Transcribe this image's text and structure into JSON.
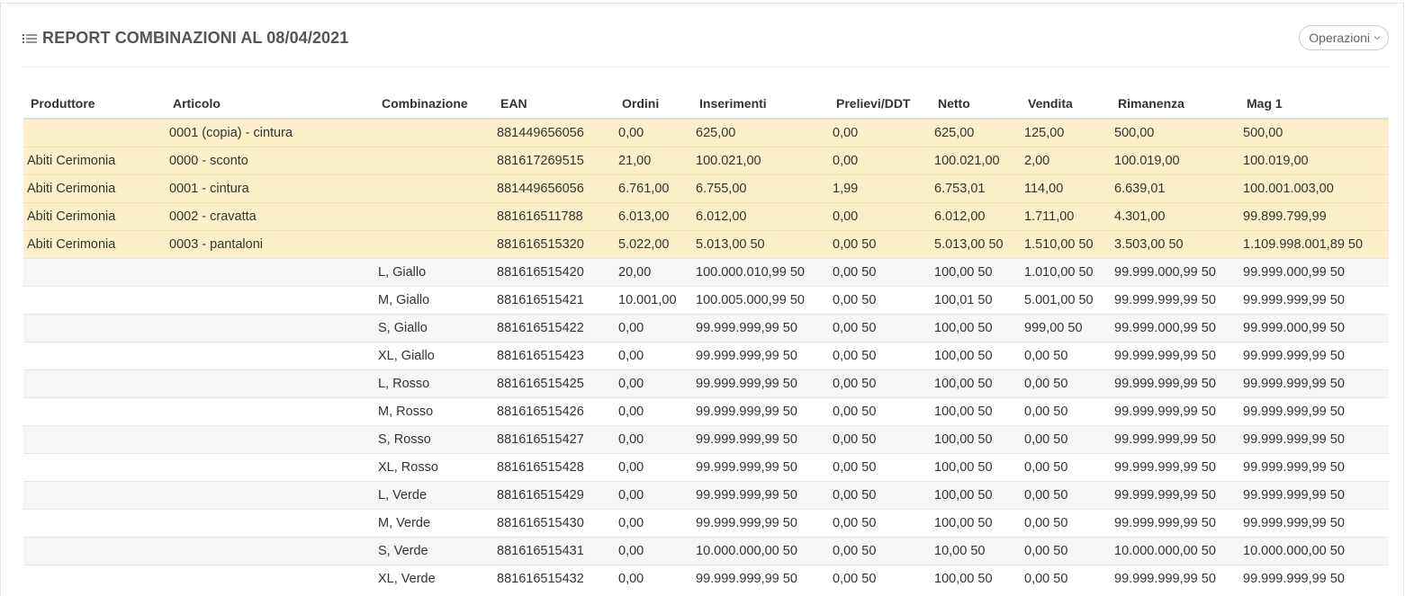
{
  "header": {
    "title": "REPORT COMBINAZIONI AL 08/04/2021",
    "title_icon": "list-icon",
    "operations_label": "Operazioni"
  },
  "table": {
    "columns": [
      "Produttore",
      "Articolo",
      "Combinazione",
      "EAN",
      "Ordini",
      "Inserimenti",
      "Prelievi/DDT",
      "Netto",
      "Vendita",
      "Rimanenza",
      "Mag 1"
    ],
    "rows": [
      {
        "type": "product",
        "cells": [
          "",
          "0001 (copia) - cintura",
          "",
          "881449656056",
          "0,00",
          "625,00",
          "0,00",
          "625,00",
          "125,00",
          "500,00",
          "500,00"
        ]
      },
      {
        "type": "product",
        "cells": [
          "Abiti Cerimonia",
          "0000 - sconto",
          "",
          "881617269515",
          "21,00",
          "100.021,00",
          "0,00",
          "100.021,00",
          "2,00",
          "100.019,00",
          "100.019,00"
        ]
      },
      {
        "type": "product",
        "cells": [
          "Abiti Cerimonia",
          "0001 - cintura",
          "",
          "881449656056",
          "6.761,00",
          "6.755,00",
          "1,99",
          "6.753,01",
          "114,00",
          "6.639,01",
          "100.001.003,00"
        ]
      },
      {
        "type": "product",
        "cells": [
          "Abiti Cerimonia",
          "0002 - cravatta",
          "",
          "881616511788",
          "6.013,00",
          "6.012,00",
          "0,00",
          "6.012,00",
          "1.711,00",
          "4.301,00",
          "99.899.799,99"
        ]
      },
      {
        "type": "product",
        "cells": [
          "Abiti Cerimonia",
          "0003 - pantaloni",
          "",
          "881616515320",
          "5.022,00",
          "5.013,00 50",
          "0,00 50",
          "5.013,00 50",
          "1.510,00 50",
          "3.503,00 50",
          "1.109.998.001,89 50"
        ]
      },
      {
        "type": "combination",
        "cells": [
          "",
          "",
          "L, Giallo",
          "881616515420",
          "20,00",
          "100.000.010,99 50",
          "0,00 50",
          "100,00 50",
          "1.010,00 50",
          "99.999.000,99 50",
          "99.999.000,99 50"
        ]
      },
      {
        "type": "combination",
        "cells": [
          "",
          "",
          "M, Giallo",
          "881616515421",
          "10.001,00",
          "100.005.000,99 50",
          "0,00 50",
          "100,01 50",
          "5.001,00 50",
          "99.999.999,99 50",
          "99.999.999,99 50"
        ]
      },
      {
        "type": "combination",
        "cells": [
          "",
          "",
          "S, Giallo",
          "881616515422",
          "0,00",
          "99.999.999,99 50",
          "0,00 50",
          "100,00 50",
          "999,00 50",
          "99.999.000,99 50",
          "99.999.000,99 50"
        ]
      },
      {
        "type": "combination",
        "cells": [
          "",
          "",
          "XL, Giallo",
          "881616515423",
          "0,00",
          "99.999.999,99 50",
          "0,00 50",
          "100,00 50",
          "0,00 50",
          "99.999.999,99 50",
          "99.999.999,99 50"
        ]
      },
      {
        "type": "combination",
        "cells": [
          "",
          "",
          "L, Rosso",
          "881616515425",
          "0,00",
          "99.999.999,99 50",
          "0,00 50",
          "100,00 50",
          "0,00 50",
          "99.999.999,99 50",
          "99.999.999,99 50"
        ]
      },
      {
        "type": "combination",
        "cells": [
          "",
          "",
          "M, Rosso",
          "881616515426",
          "0,00",
          "99.999.999,99 50",
          "0,00 50",
          "100,00 50",
          "0,00 50",
          "99.999.999,99 50",
          "99.999.999,99 50"
        ]
      },
      {
        "type": "combination",
        "cells": [
          "",
          "",
          "S, Rosso",
          "881616515427",
          "0,00",
          "99.999.999,99 50",
          "0,00 50",
          "100,00 50",
          "0,00 50",
          "99.999.999,99 50",
          "99.999.999,99 50"
        ]
      },
      {
        "type": "combination",
        "cells": [
          "",
          "",
          "XL, Rosso",
          "881616515428",
          "0,00",
          "99.999.999,99 50",
          "0,00 50",
          "100,00 50",
          "0,00 50",
          "99.999.999,99 50",
          "99.999.999,99 50"
        ]
      },
      {
        "type": "combination",
        "cells": [
          "",
          "",
          "L, Verde",
          "881616515429",
          "0,00",
          "99.999.999,99 50",
          "0,00 50",
          "100,00 50",
          "0,00 50",
          "99.999.999,99 50",
          "99.999.999,99 50"
        ]
      },
      {
        "type": "combination",
        "cells": [
          "",
          "",
          "M, Verde",
          "881616515430",
          "0,00",
          "99.999.999,99 50",
          "0,00 50",
          "100,00 50",
          "0,00 50",
          "99.999.999,99 50",
          "99.999.999,99 50"
        ]
      },
      {
        "type": "combination",
        "cells": [
          "",
          "",
          "S, Verde",
          "881616515431",
          "0,00",
          "10.000.000,00 50",
          "0,00 50",
          "10,00 50",
          "0,00 50",
          "10.000.000,00 50",
          "10.000.000,00 50"
        ]
      },
      {
        "type": "combination",
        "cells": [
          "",
          "",
          "XL, Verde",
          "881616515432",
          "0,00",
          "99.999.999,99 50",
          "0,00 50",
          "100,00 50",
          "0,00 50",
          "99.999.999,99 50",
          "99.999.999,99 50"
        ]
      }
    ]
  },
  "colors": {
    "product_row_bg": "#fcefc9",
    "stripe_bg": "#f6f6f6",
    "title_color": "#555555"
  }
}
